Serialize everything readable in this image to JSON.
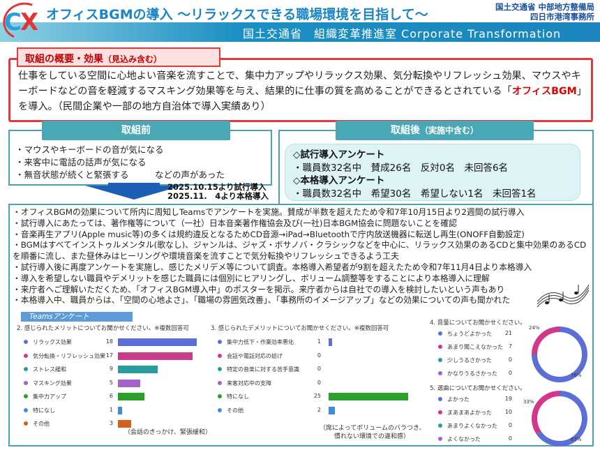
{
  "header": {
    "logo_text_c": "C",
    "logo_text_x": "X",
    "title": "オフィスBGMの導入 ～リラックスできる職場環境を目指して～",
    "org_line1": "国土交通省 中部地方整備局",
    "org_line2": "四日市港湾事務所",
    "subtitle": "国土交通省　組織変革推進室 Corporate Transformation"
  },
  "overview": {
    "label": "取組の概要・効果",
    "label_note": "（見込み含む）",
    "text_1": "仕事をしている空間に心地よい音楽を流すことで、集中力アップやリラックス効果、気分転換やリフレッシュ効果、マウスやキーボードなどの音を軽減するマスキング効果等を与え、結果的に仕事の質を高めることができるとされている「",
    "text_highlight": "オフィスBGM",
    "text_2": "」を導入。（民間企業や一部の地方自治体で導入実績あり）"
  },
  "before": {
    "label": "取組前",
    "items": [
      "・マウスやキーボードの音が気になる",
      "・来客中に電話の話声が気になる",
      "・無音状態が続くと緊張する　　　などの声があった"
    ]
  },
  "after": {
    "label": "取組後",
    "label_note": "（実施中含む）",
    "trial_heading": "◇試行導入アンケート",
    "trial_result": "・職員数32名中　賛成26名　反対0名　未回答6名",
    "full_heading": "◇本格導入アンケート",
    "full_result": "・職員数32名中　希望30名　希望しない1名　未回答1名"
  },
  "dates": {
    "line1": "2025.10.15より試行導入",
    "line2": "2025.11.　4より本格導入"
  },
  "body_items": [
    "・オフィスBGMの効果について所内に周知しTeamsでアンケートを実施。賛成が半数を超えたため令和7年10月15日より2週間の試行導入",
    "・試行導入にあたっては、著作権等について（一社）日本音楽著作権協会及び(一社)日本BGM協会に問題ないことを確認",
    "・音楽再生アプリ(Apple music等)の多くは規約違反となるためCD音源→iPad→Bluetoothで庁内放送機器に転送し再生(ONOFF自動設定)",
    "・BGMはすべてインストゥルメンタル(歌なし)、ジャンルは、ジャズ・ボサノバ・クラシックなどを中心に、リラックス効果のあるCDと集中効果のあるCDを順番に流し、また昼休みはヒーリングや環境音楽を流すことで気分転換やリフレッシュできるよう工夫",
    "・試行導入後に再度アンケートを実施し、感じたメリデメ等について調査。本格導入希望者が9割を超えたため令和7年11月4日より本格導入",
    "・導入を希望しない職員やデメリットを感じた職員には個別にヒアリングし、ボリューム調整等をすることにより本格導入に理解",
    "・来庁者へご理解いただくため、「オフィスBGM導入中」のポスターを掲示。来庁者からは自社での導入を検討したいという声もあり",
    "・本格導入中、職員からは、「空間の心地よさ」、「職場の雰囲気改善」、「事務所のイメージアップ」などの効果についての声も聞かれた"
  ],
  "survey": {
    "tag": "Teamsアンケート",
    "q2": {
      "title": "2. 感じられたメリットについてお聞かせください。※複数回答可",
      "note": "（会話のきっかけ、緊張緩和）"
    },
    "q3": {
      "title": "3. 感じられたデメリットについてお聞かせください。※複数回答可",
      "note_line1": "（席によってボリュームのバラつき、",
      "note_line2": "慣れない環境での違和感）"
    },
    "q4": {
      "title": "4. 音量についてお聞かせください。"
    },
    "q5": {
      "title": "5. 選曲についてお聞かせください。"
    }
  },
  "chart_data": [
    {
      "type": "bar",
      "title": "2. 感じられたメリットについてお聞かせください。※複数回答可",
      "categories": [
        "リラックス効果",
        "気分転換・リフレッシュ効果",
        "ストレス緩和",
        "マスキング効果",
        "集中力アップ",
        "特になし",
        "その他"
      ],
      "values": [
        18,
        17,
        9,
        5,
        6,
        1,
        3
      ],
      "colors": [
        "#5b6fd6",
        "#c83c8c",
        "#2a9c9c",
        "#a463c9",
        "#2c9e2c",
        "#3a8fd8",
        "#d0621e"
      ],
      "xlim": [
        0,
        20
      ]
    },
    {
      "type": "bar",
      "title": "3. 感じられたデメリットについてお聞かせください。※複数回答可",
      "categories": [
        "集中力低下・作業効率悪化",
        "会話や電話対応の妨げ",
        "特定の音楽に対する苦手意識",
        "来客対応中の支障",
        "特になし",
        "その他"
      ],
      "values": [
        1,
        0,
        0,
        0,
        25,
        2
      ],
      "colors": [
        "#5b6fd6",
        "#c83c8c",
        "#2a9c9c",
        "#a463c9",
        "#2c9e2c",
        "#3a8fd8"
      ],
      "xlim": [
        0,
        25
      ]
    },
    {
      "type": "pie",
      "title": "4. 音量についてお聞かせください。",
      "categories": [
        "ちょうどよかった",
        "あまり聞こえなかった",
        "少しうるさかった",
        "かなりうるさかった"
      ],
      "values": [
        21,
        7,
        0,
        0
      ],
      "percent_labels": [
        "76%",
        "24%"
      ],
      "colors": [
        "#5b6fd6",
        "#d2378a",
        "#2a9c9c",
        "#a463c9"
      ]
    },
    {
      "type": "pie",
      "title": "5. 選曲についてお聞かせください。",
      "categories": [
        "よかった",
        "まあまあよかった",
        "あまりよくなかった",
        "よくなかった"
      ],
      "values": [
        19,
        10,
        0,
        0
      ],
      "percent_labels": [
        "67%",
        "33%"
      ],
      "colors": [
        "#5b6fd6",
        "#d2378a",
        "#2a9c9c",
        "#a463c9"
      ]
    }
  ]
}
